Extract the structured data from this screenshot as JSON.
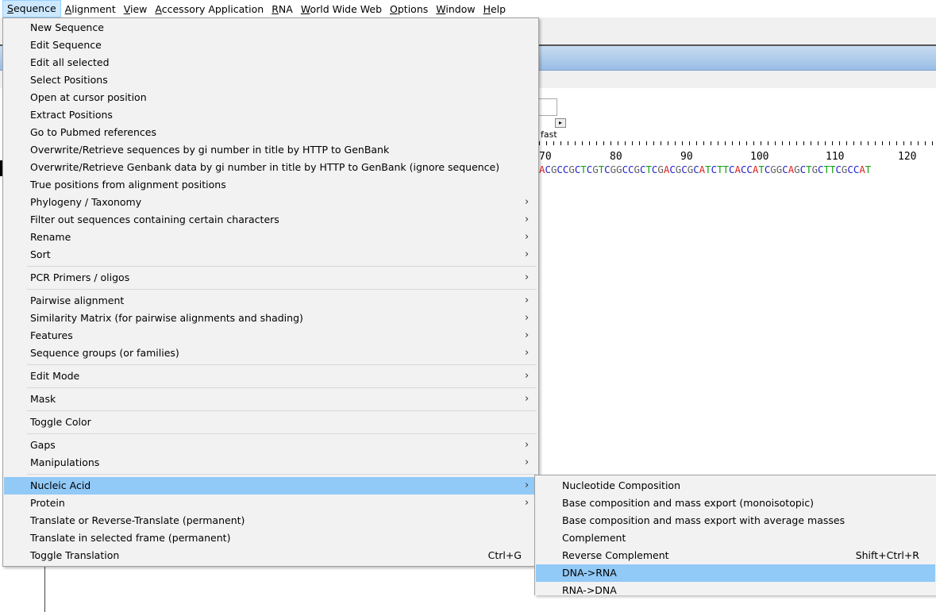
{
  "menubar": [
    {
      "label": "Sequence",
      "active": true
    },
    {
      "label": "Alignment"
    },
    {
      "label": "View"
    },
    {
      "label": "Accessory Application"
    },
    {
      "label": "RNA"
    },
    {
      "label": "World Wide Web"
    },
    {
      "label": "Options"
    },
    {
      "label": "Window"
    },
    {
      "label": "Help"
    }
  ],
  "background": {
    "speed_label": "fast",
    "ruler": [
      "70",
      "80",
      "90",
      "100",
      "110",
      "120"
    ],
    "sequence": "ACGCCGCTCGTCGGCCGCTCGACGCGCATCTTCACCATCGGCAGCTGCTTCGCCAT"
  },
  "sequence_menu": {
    "items": [
      {
        "label": "New Sequence"
      },
      {
        "label": "Edit Sequence"
      },
      {
        "label": "Edit all selected"
      },
      {
        "label": "Select Positions"
      },
      {
        "label": "Open at cursor position"
      },
      {
        "label": "Extract Positions"
      },
      {
        "label": "Go to Pubmed references"
      },
      {
        "label": "Overwrite/Retrieve sequences by gi number in title by HTTP to GenBank"
      },
      {
        "label": "Overwrite/Retrieve Genbank data by gi number in title by HTTP to GenBank (ignore sequence)"
      },
      {
        "label": "True positions from alignment positions"
      },
      {
        "label": "Phylogeny / Taxonomy",
        "submenu": true
      },
      {
        "label": "Filter out sequences containing certain characters",
        "submenu": true
      },
      {
        "label": "Rename",
        "submenu": true
      },
      {
        "label": "Sort",
        "submenu": true
      },
      {
        "separator": true
      },
      {
        "label": "PCR Primers / oligos",
        "submenu": true
      },
      {
        "separator": true
      },
      {
        "label": "Pairwise alignment",
        "submenu": true
      },
      {
        "label": "Similarity Matrix (for pairwise alignments and shading)",
        "submenu": true
      },
      {
        "label": "Features",
        "submenu": true
      },
      {
        "label": "Sequence groups (or families)",
        "submenu": true
      },
      {
        "separator": true
      },
      {
        "label": "Edit Mode",
        "submenu": true
      },
      {
        "separator": true
      },
      {
        "label": "Mask",
        "submenu": true
      },
      {
        "separator": true
      },
      {
        "label": "Toggle Color"
      },
      {
        "separator": true
      },
      {
        "label": "Gaps",
        "submenu": true
      },
      {
        "label": "Manipulations",
        "submenu": true
      },
      {
        "separator": true
      },
      {
        "label": "Nucleic Acid",
        "submenu": true,
        "highlighted": true
      },
      {
        "label": "Protein",
        "submenu": true
      },
      {
        "label": "Translate or Reverse-Translate (permanent)"
      },
      {
        "label": "Translate in selected frame (permanent)"
      },
      {
        "label": "Toggle Translation",
        "shortcut": "Ctrl+G"
      }
    ]
  },
  "nucleic_acid_submenu": {
    "items": [
      {
        "label": "Nucleotide Composition"
      },
      {
        "label": "Base composition and mass export (monoisotopic)"
      },
      {
        "label": "Base composition and mass export with average masses"
      },
      {
        "label": "Complement"
      },
      {
        "label": "Reverse Complement",
        "shortcut": "Shift+Ctrl+R"
      },
      {
        "label": "DNA->RNA",
        "highlighted": true
      },
      {
        "label": "RNA->DNA"
      }
    ]
  },
  "submenu_arrow": "›"
}
